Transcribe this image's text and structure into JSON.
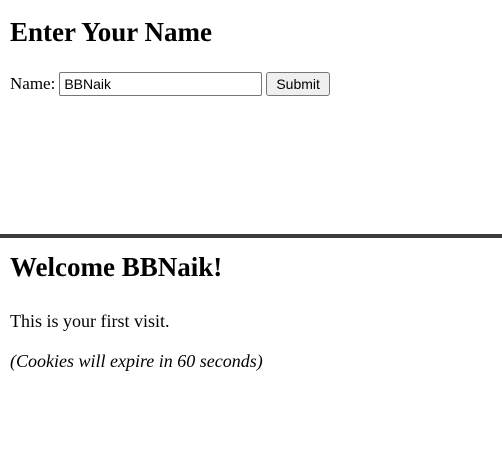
{
  "form_page": {
    "title": "Enter Your Name",
    "name_label": "Name:",
    "name_value": "BBNaik",
    "submit_label": "Submit"
  },
  "welcome_page": {
    "title": "Welcome BBNaik!",
    "visit_message": "This is your first visit.",
    "cookie_note": "(Cookies will expire in 60 seconds)"
  },
  "colors": {
    "divider": "#3c3c3c",
    "button_bg": "#efefef",
    "input_border": "#767676"
  }
}
